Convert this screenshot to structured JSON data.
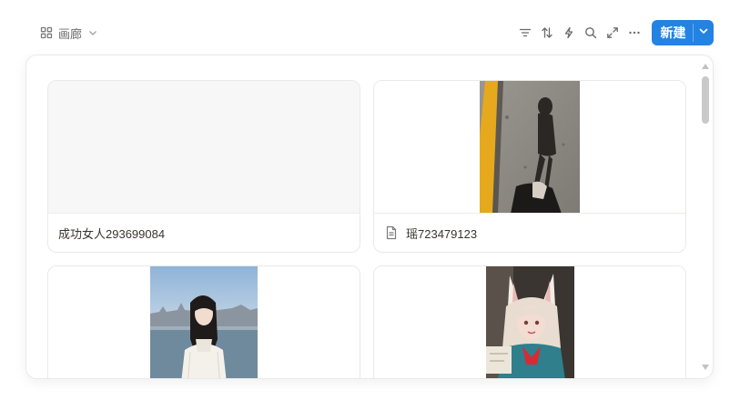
{
  "view": {
    "label": "画廊",
    "icon": "grid-icon",
    "dropdown_icon": "chevron-down-icon"
  },
  "toolbar": {
    "tools": [
      "filter-icon",
      "sort-icon",
      "lightning-icon",
      "search-icon",
      "expand-icon",
      "more-icon"
    ],
    "new_button_label": "新建",
    "accent_color": "#2383e2"
  },
  "cards": [
    {
      "title": "成功女人293699084",
      "has_page_icon": false,
      "cover": "empty"
    },
    {
      "title": "瑶723479123",
      "has_page_icon": true,
      "cover": "photo-shadow-on-pavement"
    },
    {
      "title": "",
      "has_page_icon": false,
      "cover": "photo-woman-white-sweater-seaside"
    },
    {
      "title": "",
      "has_page_icon": false,
      "cover": "photo-cosplay-fox-ears"
    }
  ]
}
